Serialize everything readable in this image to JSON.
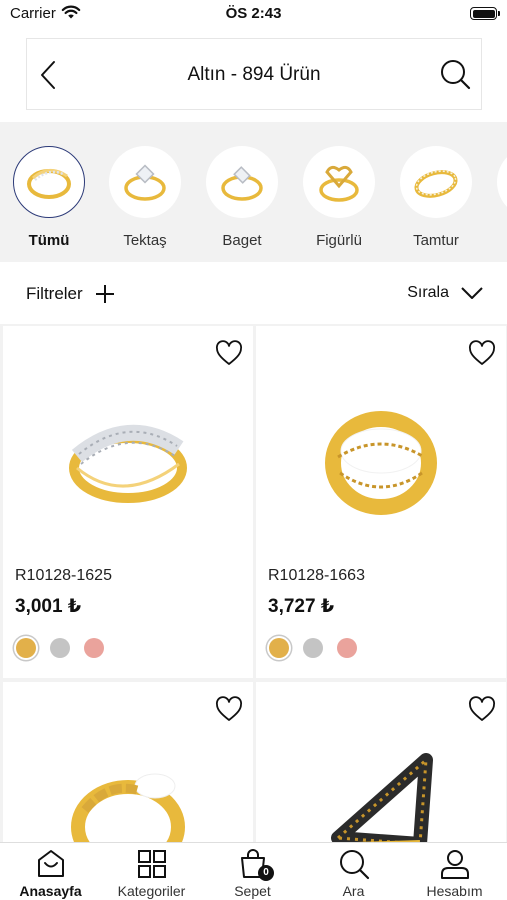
{
  "status_bar": {
    "carrier": "Carrier",
    "time": "ÖS 2:43"
  },
  "header": {
    "title": "Altın - 894 Ürün",
    "back_icon": "chevron-left-icon",
    "search_icon": "search-icon"
  },
  "categories": [
    {
      "label": "Tümü",
      "selected": true
    },
    {
      "label": "Tektaş",
      "selected": false
    },
    {
      "label": "Baget",
      "selected": false
    },
    {
      "label": "Figürlü",
      "selected": false
    },
    {
      "label": "Tamtur",
      "selected": false
    }
  ],
  "filter_bar": {
    "filters_label": "Filtreler",
    "sort_label": "Sırala"
  },
  "products": [
    {
      "code": "R10128-1625",
      "price": "3,001 ₺"
    },
    {
      "code": "R10128-1663",
      "price": "3,727 ₺"
    },
    {
      "code": "",
      "price": ""
    },
    {
      "code": "",
      "price": ""
    }
  ],
  "swatch_colors": {
    "gold": "#e2b04a",
    "silver": "#c4c4c4",
    "rose": "#eaa39c"
  },
  "colors": {
    "category_selected_border": "#2c3a78",
    "gold": "#e8b93c"
  },
  "tab_bar": {
    "items": [
      {
        "label": "Anasayfa",
        "icon": "home-bag-icon",
        "active": true
      },
      {
        "label": "Kategoriler",
        "icon": "grid-icon",
        "active": false
      },
      {
        "label": "Sepet",
        "icon": "shopping-bag-icon",
        "active": false
      },
      {
        "label": "Ara",
        "icon": "search-icon",
        "active": false
      },
      {
        "label": "Hesabım",
        "icon": "user-icon",
        "active": false
      }
    ],
    "cart_count": "0"
  }
}
